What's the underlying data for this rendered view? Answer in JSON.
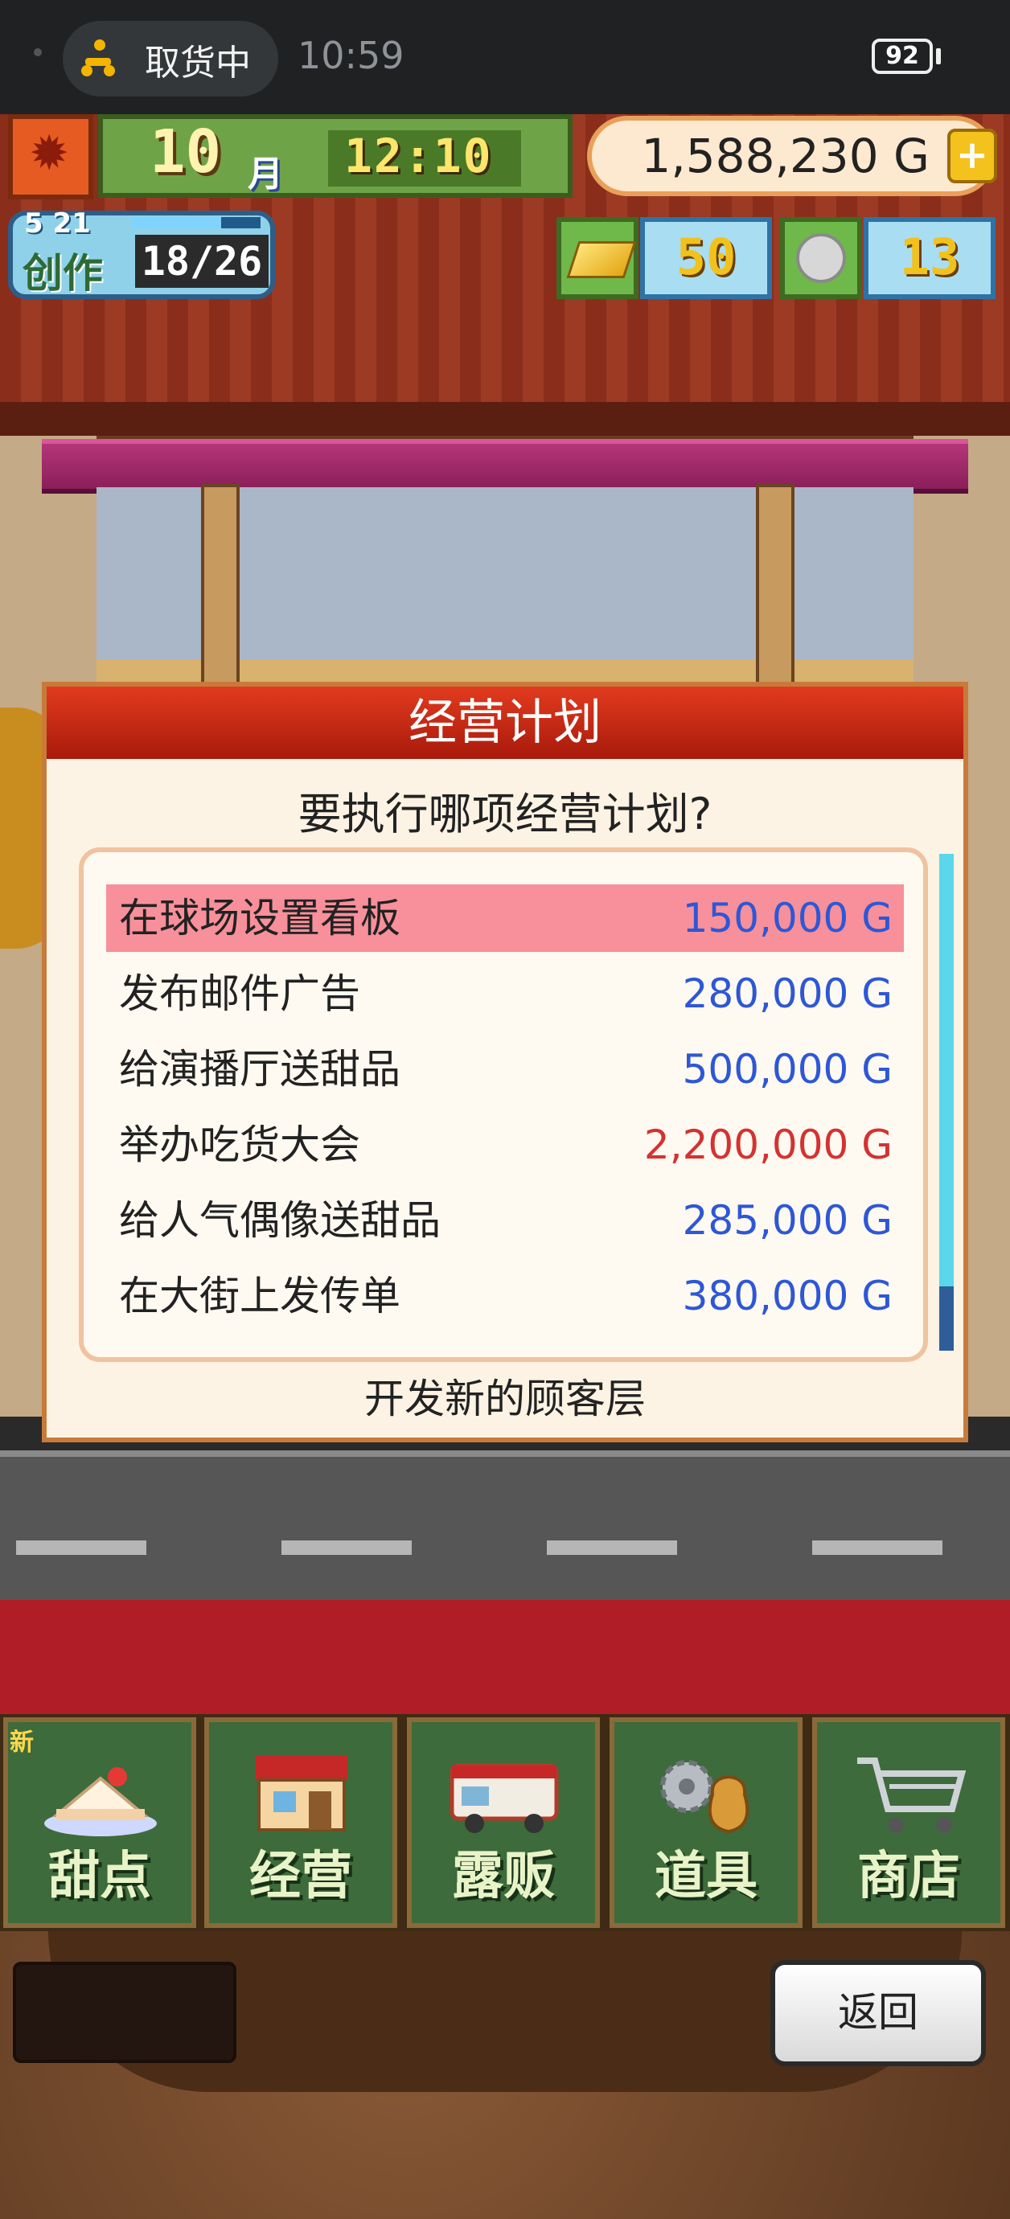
{
  "status_bar": {
    "activity": "取货中",
    "time": "10:59",
    "battery": "92"
  },
  "hud": {
    "month": "10",
    "month_unit": "月",
    "clock": "12:10",
    "money": "1,588,230 G",
    "create_rank": "5 21",
    "create_label": "创作",
    "create_progress": "18/26",
    "gold_count": "50",
    "medal_count": "13"
  },
  "modal": {
    "title": "经营计划",
    "question": "要执行哪项经营计划?",
    "plans": [
      {
        "name": "在球场设置看板",
        "cost": "150,000 G",
        "affordable": true,
        "selected": true
      },
      {
        "name": "发布邮件广告",
        "cost": "280,000 G",
        "affordable": true,
        "selected": false
      },
      {
        "name": "给演播厅送甜品",
        "cost": "500,000 G",
        "affordable": true,
        "selected": false
      },
      {
        "name": "举办吃货大会",
        "cost": "2,200,000 G",
        "affordable": false,
        "selected": false
      },
      {
        "name": "给人气偶像送甜品",
        "cost": "285,000 G",
        "affordable": true,
        "selected": false
      },
      {
        "name": "在大街上发传单",
        "cost": "380,000 G",
        "affordable": true,
        "selected": false
      }
    ],
    "footer": "开发新的顾客层"
  },
  "menu": {
    "new_badge": "新",
    "items": [
      {
        "label": "甜点",
        "icon": "cake-icon"
      },
      {
        "label": "经营",
        "icon": "shop-building-icon"
      },
      {
        "label": "露贩",
        "icon": "food-truck-icon"
      },
      {
        "label": "道具",
        "icon": "gear-and-sack-icon"
      },
      {
        "label": "商店",
        "icon": "shopping-cart-icon"
      }
    ]
  },
  "back_button": "返回",
  "colors": {
    "header_red": "#c4240f",
    "selected_row": "#f7909a",
    "cost_blue": "#2e57d6",
    "cost_red": "#d43232"
  }
}
